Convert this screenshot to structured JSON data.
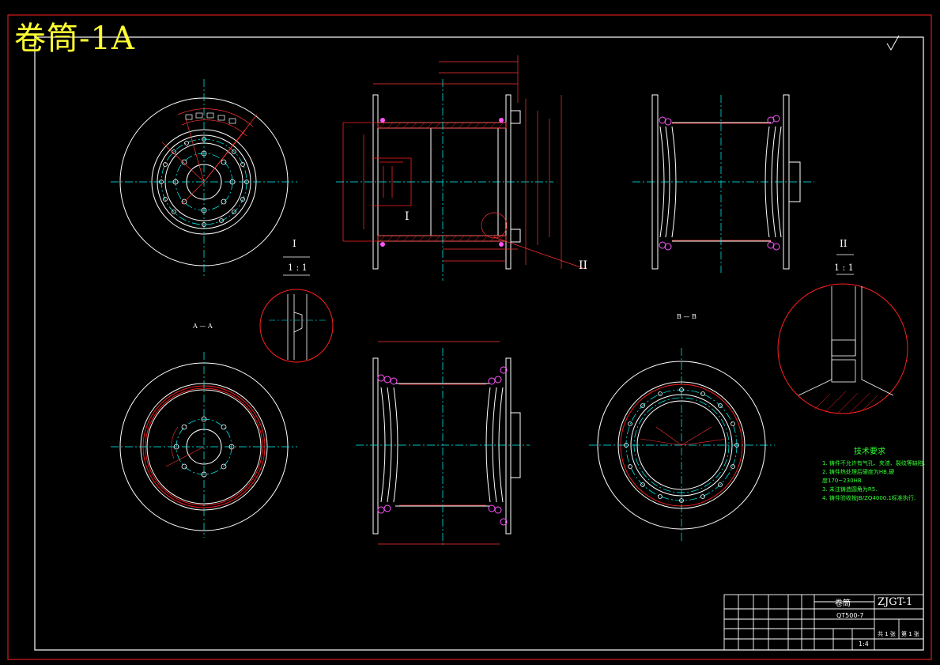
{
  "drawing_title": "卷筒-1A",
  "section_labels": {
    "detail1_roman": "I",
    "detail1_scale": "1 : 1",
    "detail2_roman": "II",
    "detail2_scale": "1 : 1",
    "callout1": "I",
    "callout2": "II",
    "view_aa": "A — A",
    "view_bb": "B — B"
  },
  "tech_requirements": {
    "heading": "技术要求",
    "items": [
      "1. 铸件不允许有气孔、夹渣、裂纹等缺陷.",
      "2. 铸件热处理后硬度为HB,硬",
      "   度170~230HB.",
      "3. 未注铸造圆角为R5.",
      "4. 铸件验收按JB/ZQ4000.1标准执行."
    ]
  },
  "title_block": {
    "part_name": "卷筒",
    "drawing_no": "ZJGT-1",
    "material": "QT500-7",
    "scale": "1:4",
    "sheet_total": "共 1 张",
    "sheet_no": "第 1 张"
  },
  "colors": {
    "border": "#ff2020",
    "line": "#ffffff",
    "center": "#00ffff",
    "dim": "#ff3333",
    "hatch": "#ff2020",
    "accent": "#ff55ff",
    "note": "#33ff33",
    "title": "#ffff33"
  }
}
